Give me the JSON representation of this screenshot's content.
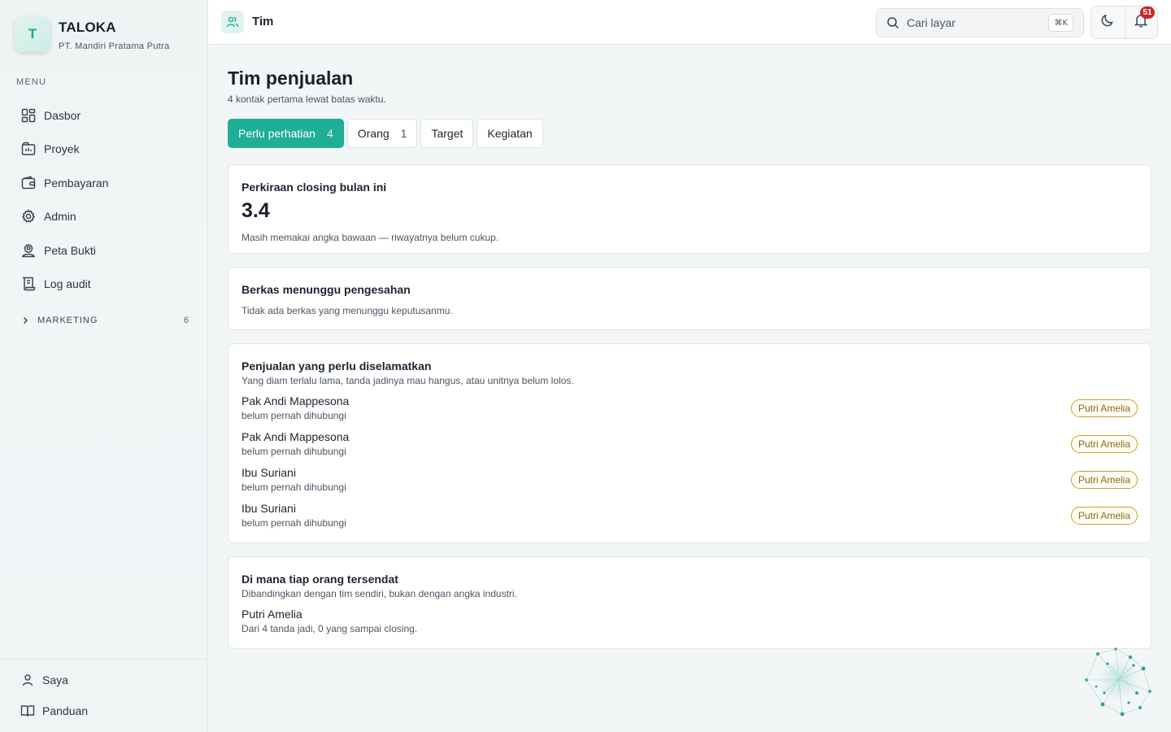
{
  "brand": {
    "initial": "T",
    "name": "TALOKA",
    "company": "PT. Mandiri Pratama Putra"
  },
  "sidebar": {
    "menu_heading": "MENU",
    "items": [
      {
        "label": "Dasbor",
        "icon": "dashboard-icon"
      },
      {
        "label": "Proyek",
        "icon": "building-icon"
      },
      {
        "label": "Pembayaran",
        "icon": "wallet-icon"
      },
      {
        "label": "Admin",
        "icon": "gear-icon"
      },
      {
        "label": "Peta Bukti",
        "icon": "user-pin-icon"
      },
      {
        "label": "Log audit",
        "icon": "scroll-icon"
      }
    ],
    "group": {
      "label": "MARKETING",
      "count": "6"
    },
    "bottom_items": [
      {
        "label": "Saya",
        "icon": "user-icon"
      },
      {
        "label": "Panduan",
        "icon": "book-icon"
      }
    ]
  },
  "topbar": {
    "title": "Tim",
    "search_placeholder": "Cari layar",
    "shortcut": "⌘K",
    "notif_count": "51"
  },
  "page": {
    "title": "Tim penjualan",
    "subtitle": "4 kontak pertama lewat batas waktu.",
    "tabs": [
      {
        "label": "Perlu perhatian",
        "count": "4",
        "active": true
      },
      {
        "label": "Orang",
        "count": "1",
        "active": false
      },
      {
        "label": "Target",
        "count": "",
        "active": false
      },
      {
        "label": "Kegiatan",
        "count": "",
        "active": false
      }
    ]
  },
  "forecast": {
    "title": "Perkiraan closing bulan ini",
    "value": "3.4",
    "note": "Masih memakai angka bawaan — riwayatnya belum cukup."
  },
  "approvals": {
    "title": "Berkas menunggu pengesahan",
    "note": "Tidak ada berkas yang menunggu keputusanmu."
  },
  "rescue": {
    "title": "Penjualan yang perlu diselamatkan",
    "note": "Yang diam terlalu lama, tanda jadinya mau hangus, atau unitnya belum lolos.",
    "deals": [
      {
        "name": "Pak Andi Mappesona",
        "status": "belum pernah dihubungi",
        "owner": "Putri Amelia"
      },
      {
        "name": "Pak Andi Mappesona",
        "status": "belum pernah dihubungi",
        "owner": "Putri Amelia"
      },
      {
        "name": "Ibu Suriani",
        "status": "belum pernah dihubungi",
        "owner": "Putri Amelia"
      },
      {
        "name": "Ibu Suriani",
        "status": "belum pernah dihubungi",
        "owner": "Putri Amelia"
      }
    ]
  },
  "stuck": {
    "title": "Di mana tiap orang tersendat",
    "note": "Dibandingkan dengan tim sendiri, bukan dengan angka industri.",
    "people": [
      {
        "name": "Putri Amelia",
        "stat": "Dari 4 tanda jadi, 0 yang sampai closing."
      }
    ]
  },
  "colors": {
    "accent": "#1fae96",
    "badge": "#c7262a",
    "owner_pill": "#c9a227"
  }
}
